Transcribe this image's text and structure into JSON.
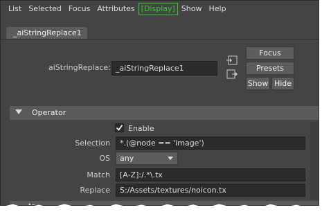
{
  "menu": {
    "items": [
      "List",
      "Selected",
      "Focus",
      "Attributes",
      "Display",
      "Show",
      "Help"
    ],
    "active": "Display"
  },
  "tab": {
    "label": "_aiStringReplace1"
  },
  "node": {
    "label": "aiStringReplace:",
    "value": "_aiStringReplace1"
  },
  "buttons": {
    "focus": "Focus",
    "presets": "Presets",
    "show": "Show",
    "hide": "Hide"
  },
  "operator": {
    "title": "Operator",
    "enable_label": "Enable",
    "enable_checked": true,
    "selection_label": "Selection",
    "selection_value": "*.(@node == 'image')",
    "os_label": "OS",
    "os_value": "any",
    "match_label": "Match",
    "match_value": "[A-Z]:/.*\\.tx",
    "replace_label": "Replace",
    "replace_value": "S:/Assets/textures/noicon.tx"
  },
  "bottom_section": {
    "title": "ts"
  },
  "colors": {
    "active_menu": "#2ed12e",
    "background": "#444444",
    "field": "#2b2b2b"
  }
}
